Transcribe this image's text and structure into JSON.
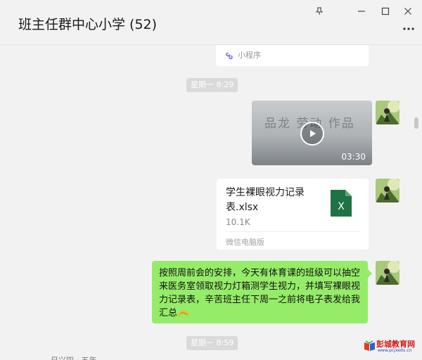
{
  "window": {
    "title": "班主任群中心小学 (52)",
    "controls": [
      "pin-icon",
      "minimize-icon",
      "maximize-icon",
      "close-icon"
    ],
    "more_icon": "more-dots-icon"
  },
  "messages": {
    "mini_program_label": "小程序",
    "time1": "星期一 8:29",
    "video": {
      "duration": "03:30",
      "thumbnail_text": "品龙 劳动 作品"
    },
    "file": {
      "name": "学生裸眼视力记录表.xlsx",
      "size": "10.1K",
      "source": "微信电脑版",
      "icon": "excel-icon",
      "icon_letter": "X"
    },
    "text_message": "按照周前会的安排，今天有体育课的班级可以抽空来医务室领取视力灯箱测学生视力，并填写裸眼视力记录表，辛苦班主任下周一之前将电子表发给我汇总",
    "time2": "星期一 8:59",
    "partial_text": "日兴四 · 五年"
  },
  "watermark": {
    "brand": "彭城教育网",
    "url": "www.pcjxedu.cn"
  },
  "colors": {
    "bubble_green": "#95ec69",
    "background": "#f2f2f2",
    "excel_green": "#1f7244",
    "chip_gray": "#dadada"
  }
}
